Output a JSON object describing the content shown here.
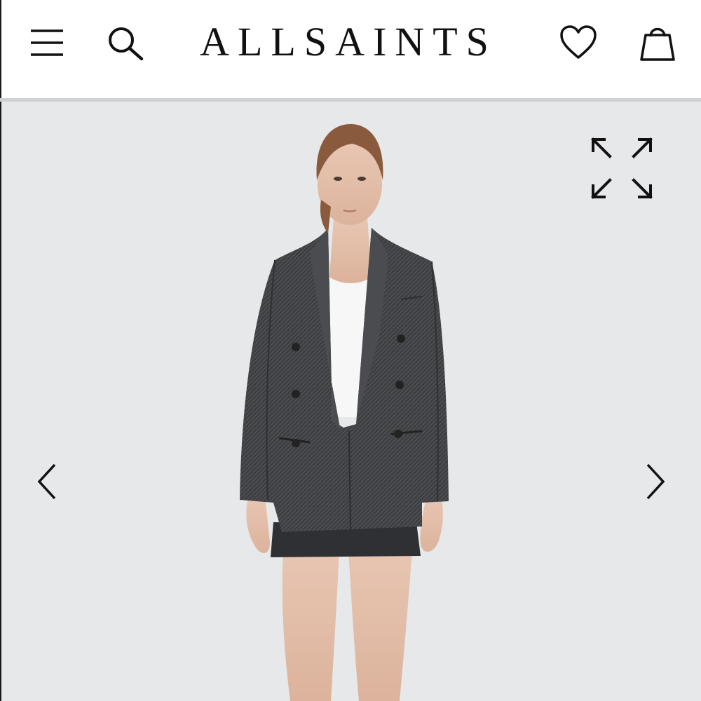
{
  "header": {
    "brand": "ALLSAINTS",
    "menu_icon": "hamburger-menu-icon",
    "search_icon": "search-icon",
    "wishlist_icon": "heart-icon",
    "bag_icon": "shopping-bag-icon"
  },
  "gallery": {
    "expand_icon": "expand-arrows-icon",
    "prev_icon": "chevron-left-icon",
    "next_icon": "chevron-right-icon",
    "background_color": "#e7e8ea"
  }
}
